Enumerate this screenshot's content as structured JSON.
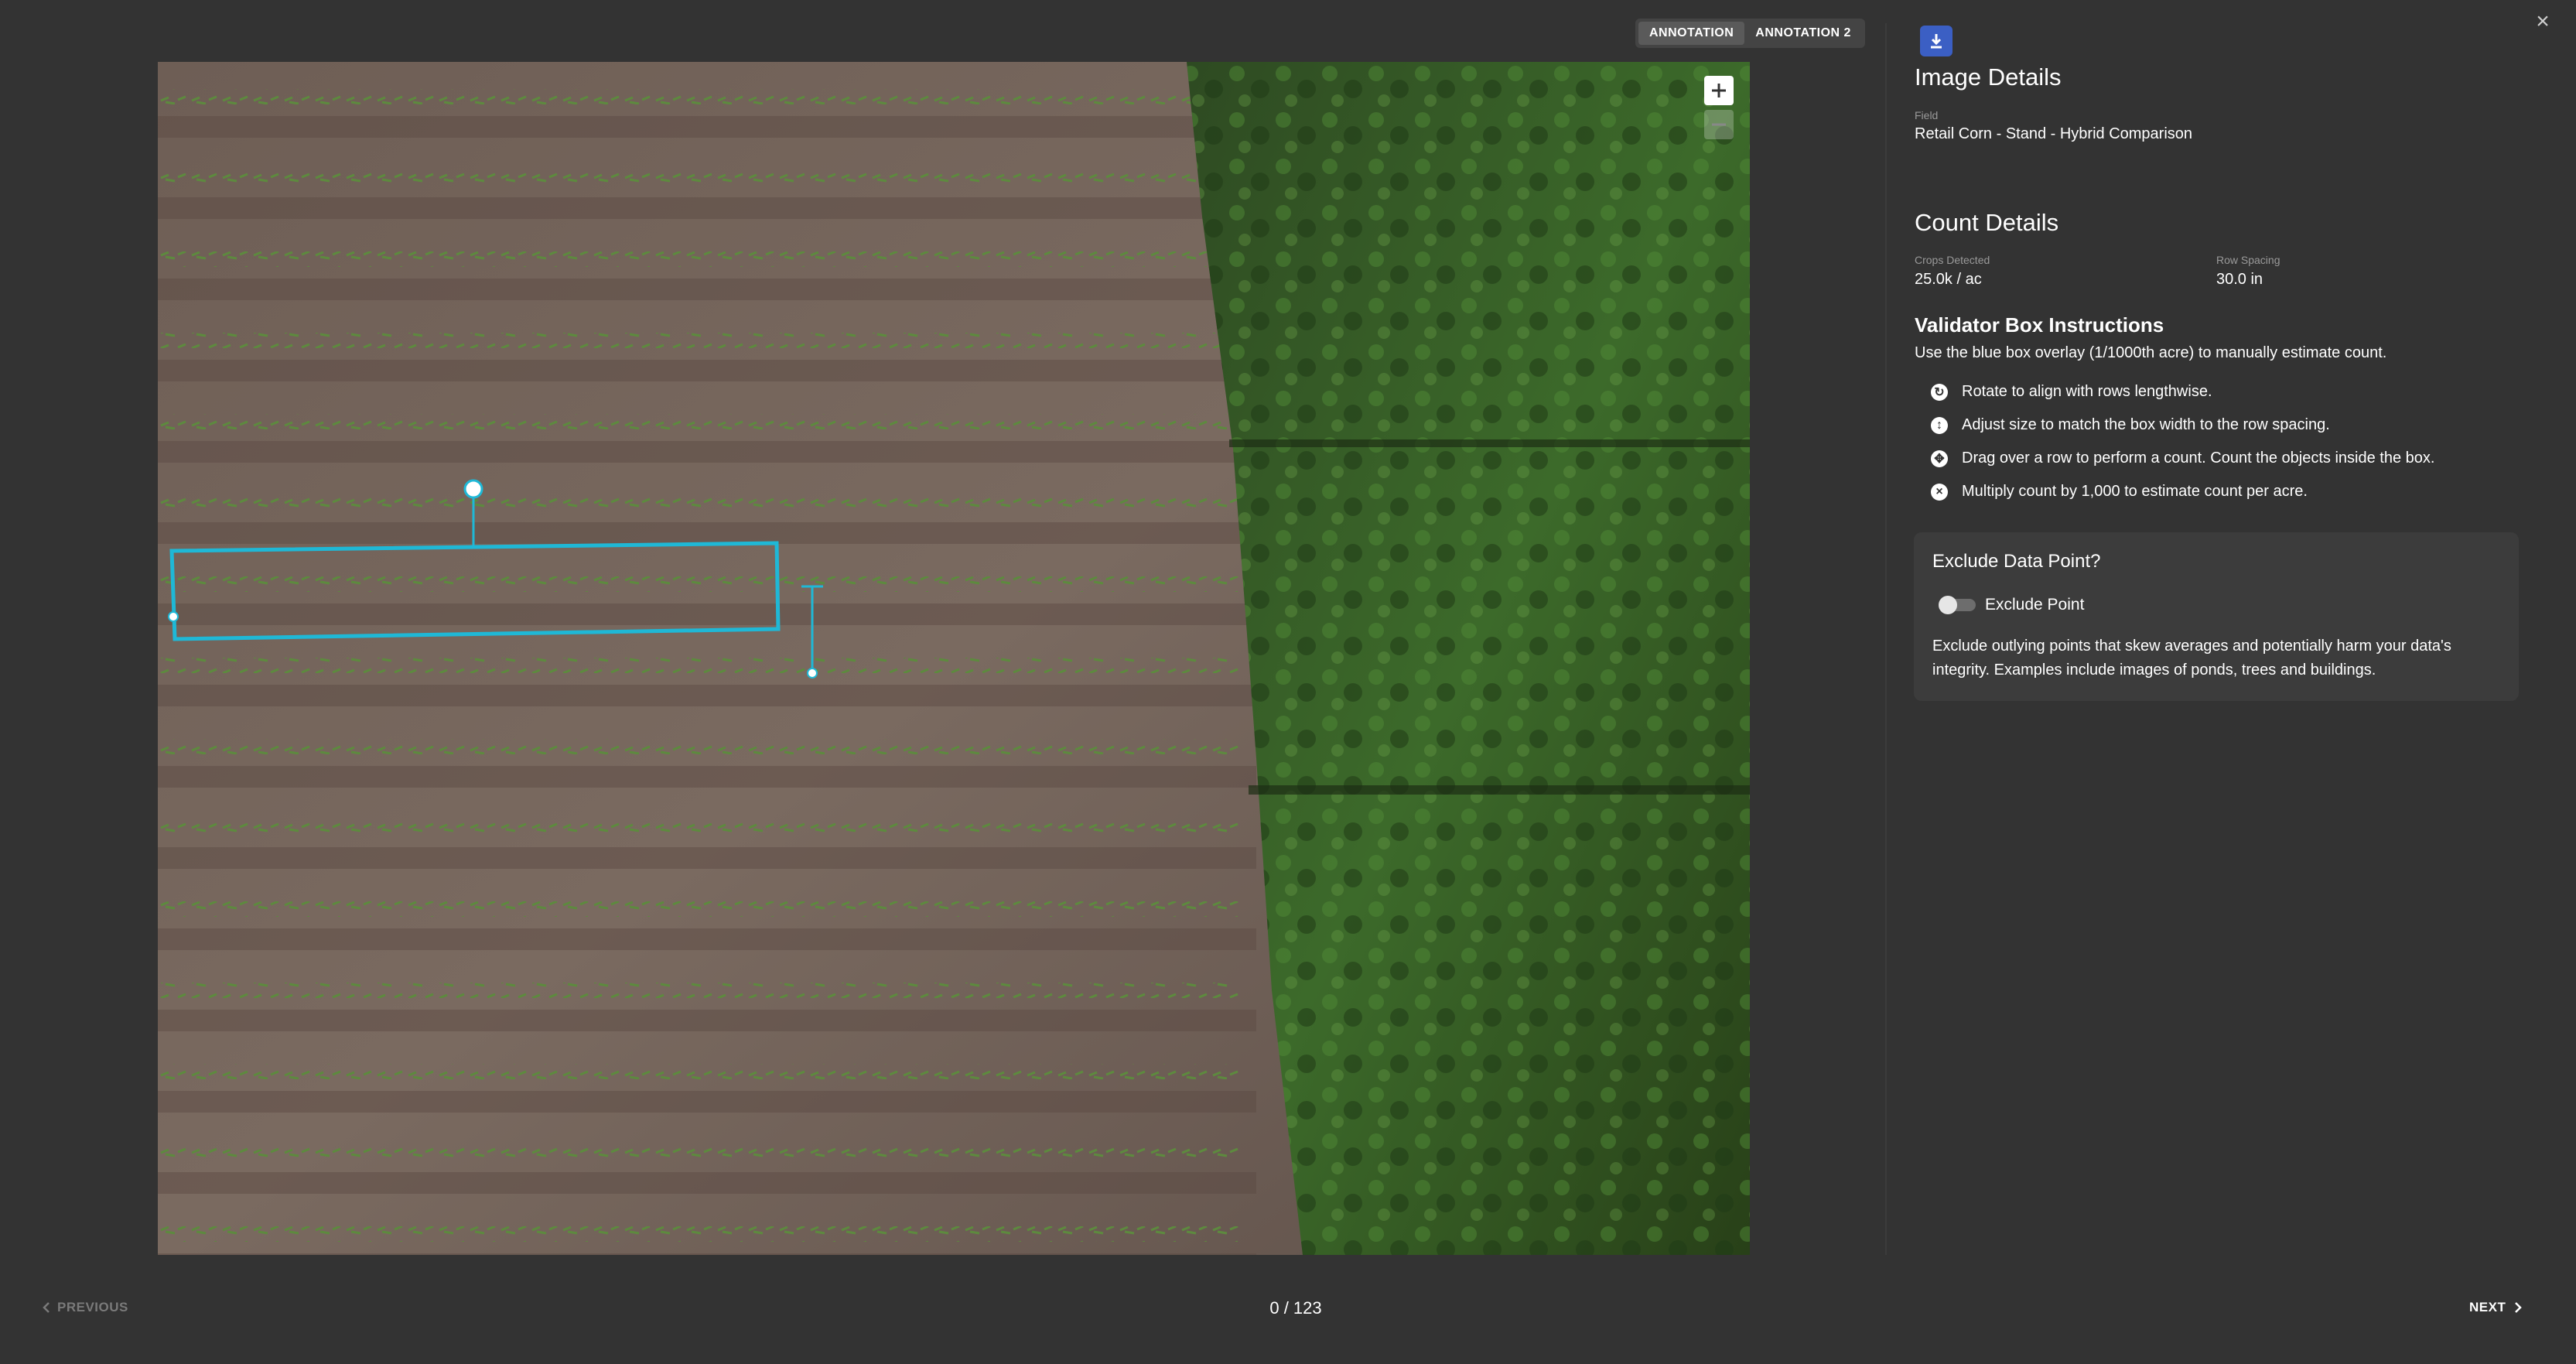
{
  "tabs": [
    {
      "label": "ANNOTATION",
      "active": true
    },
    {
      "label": "ANNOTATION 2",
      "active": false
    }
  ],
  "image_details": {
    "title": "Image Details",
    "field_label": "Field",
    "field_value": "Retail Corn - Stand - Hybrid Comparison"
  },
  "count_details": {
    "title": "Count Details",
    "crops_label": "Crops Detected",
    "crops_value": "25.0k / ac",
    "spacing_label": "Row Spacing",
    "spacing_value": "30.0 in"
  },
  "validator": {
    "title": "Validator Box Instructions",
    "intro": "Use the blue box overlay (1/1000th acre) to manually estimate count.",
    "items": [
      {
        "icon": "rotate-icon",
        "text": "Rotate to align with rows lengthwise."
      },
      {
        "icon": "resize-icon",
        "text": "Adjust size to match the box width to the row spacing."
      },
      {
        "icon": "move-icon",
        "text": "Drag over a row to perform a count. Count the objects inside the box."
      },
      {
        "icon": "multiply-icon",
        "text": "Multiply count by 1,000 to estimate count per acre."
      }
    ]
  },
  "exclude": {
    "title": "Exclude Data Point?",
    "toggle_label": "Exclude Point",
    "toggle_on": false,
    "description": "Exclude outlying points that skew averages and potentially harm your data's integrity. Examples include images of ponds, trees and buildings."
  },
  "nav": {
    "previous": "PREVIOUS",
    "next": "NEXT",
    "pager": "0 / 123"
  },
  "colors": {
    "background": "#333333",
    "accent": "#3b5fc4",
    "validator_box": "#1fb8d6"
  }
}
